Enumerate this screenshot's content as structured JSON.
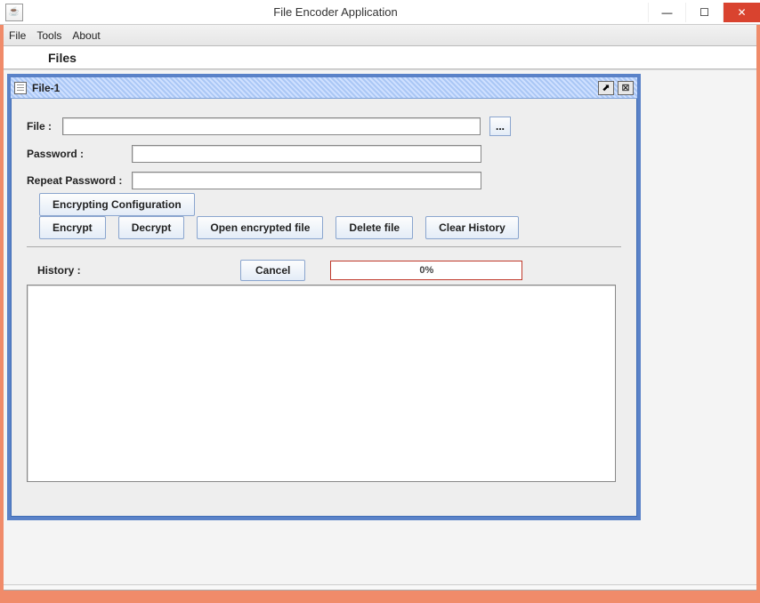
{
  "window": {
    "title": "File Encoder Application",
    "java_icon_text": "☕",
    "minimize": "—",
    "maximize": "☐",
    "close": "✕"
  },
  "menu": {
    "file": "File",
    "tools": "Tools",
    "about": "About"
  },
  "section": {
    "files": "Files"
  },
  "internal": {
    "title": "File-1",
    "maximize": "⬈",
    "close": "⊠"
  },
  "form": {
    "file_label": "File :",
    "file_value": "",
    "browse_label": "...",
    "password_label": "Password :",
    "password_value": "",
    "repeat_label": "Repeat Password :",
    "repeat_value": ""
  },
  "buttons": {
    "config": "Encrypting Configuration",
    "encrypt": "Encrypt",
    "decrypt": "Decrypt",
    "open": "Open encrypted file",
    "delete": "Delete file",
    "clear": "Clear History",
    "cancel": "Cancel"
  },
  "history": {
    "label": "History :",
    "progress_text": "0%"
  }
}
